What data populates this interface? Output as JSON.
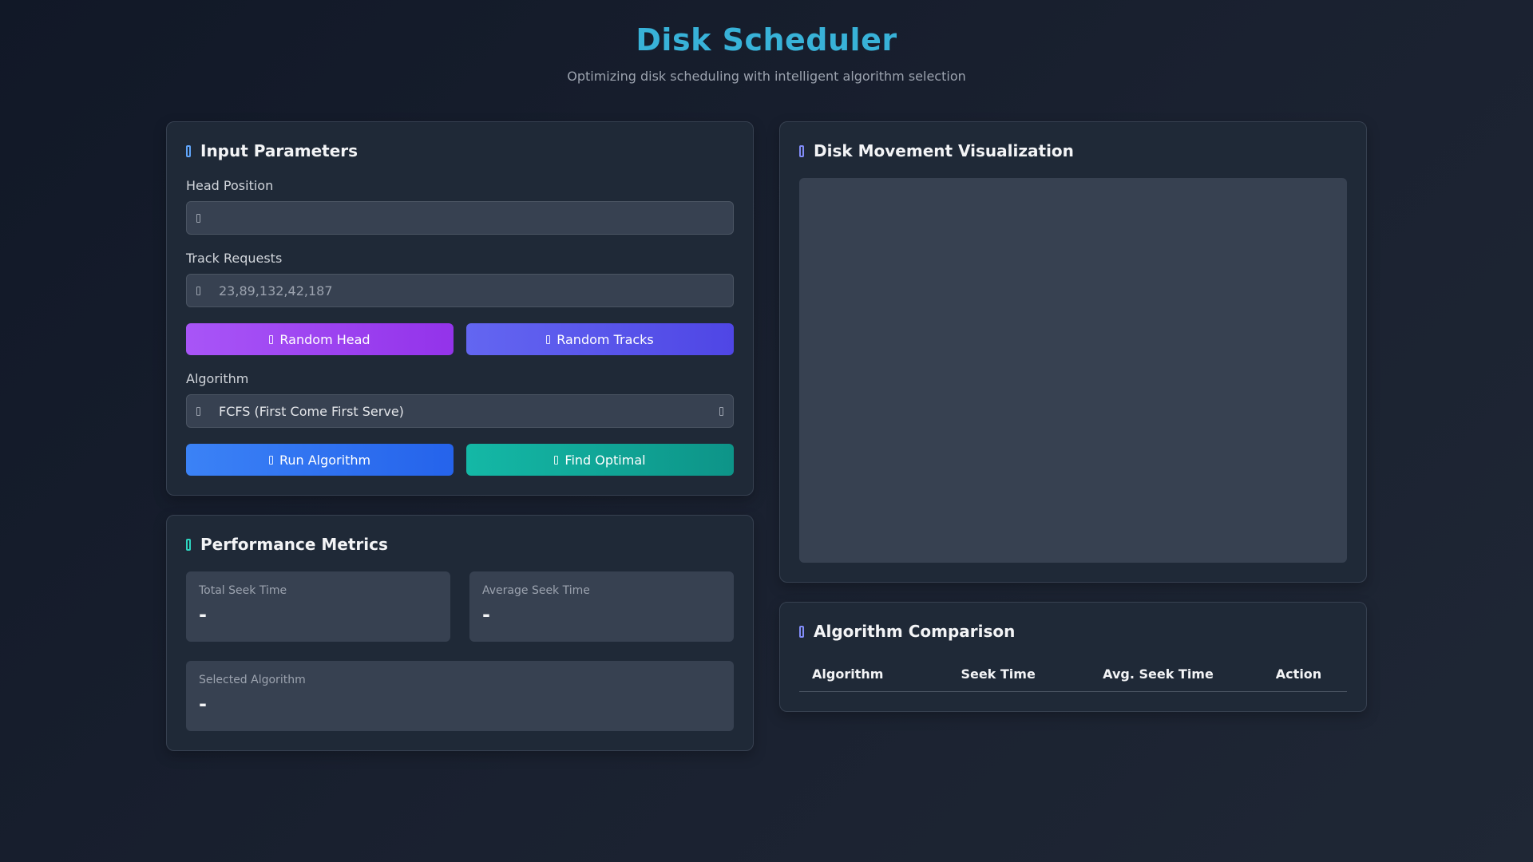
{
  "header": {
    "title": "Disk Scheduler",
    "subtitle": "Optimizing disk scheduling with intelligent algorithm selection"
  },
  "input_card": {
    "title": "Input Parameters",
    "icon": "sliders-icon",
    "head_position": {
      "label": "Head Position",
      "value": "",
      "placeholder": ""
    },
    "track_requests": {
      "label": "Track Requests",
      "value": "",
      "placeholder": "23,89,132,42,187"
    },
    "random_head_label": "Random Head",
    "random_tracks_label": "Random Tracks",
    "algorithm": {
      "label": "Algorithm",
      "selected": "FCFS (First Come First Serve)"
    },
    "run_label": "Run Algorithm",
    "optimal_label": "Find Optimal"
  },
  "metrics_card": {
    "title": "Performance Metrics",
    "total_seek": {
      "label": "Total Seek Time",
      "value": "-"
    },
    "avg_seek": {
      "label": "Average Seek Time",
      "value": "-"
    },
    "selected_algo": {
      "label": "Selected Algorithm",
      "value": "-"
    }
  },
  "viz_card": {
    "title": "Disk Movement Visualization"
  },
  "comparison_card": {
    "title": "Algorithm Comparison",
    "columns": [
      "Algorithm",
      "Seek Time",
      "Avg. Seek Time",
      "Action"
    ],
    "rows": []
  },
  "colors": {
    "accent_title": "#38b2d8",
    "card_bg": "#1f2937",
    "btn_purple": "#a855f7",
    "btn_indigo": "#6366f1",
    "btn_blue": "#3b82f6",
    "btn_teal": "#14b8a6"
  }
}
